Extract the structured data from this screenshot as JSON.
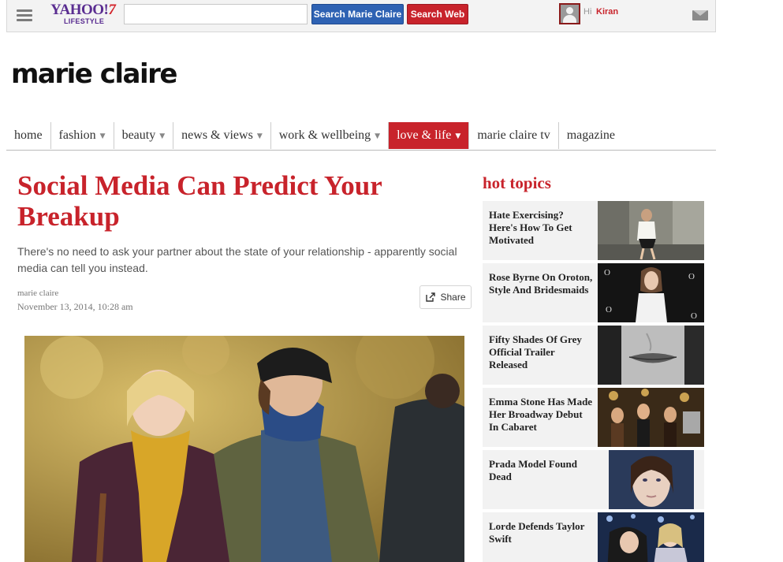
{
  "topbar": {
    "logo_text": "YAHOO!",
    "logo_seven": "7",
    "logo_sub": "LIFESTYLE",
    "search_value": "",
    "search_mc_label": "Search Marie Claire",
    "search_web_label": "Search Web",
    "greeting": "Hi",
    "username": "Kiran"
  },
  "brand": {
    "name": "marie claire"
  },
  "nav": [
    {
      "label": "home",
      "dropdown": false
    },
    {
      "label": "fashion",
      "dropdown": true
    },
    {
      "label": "beauty",
      "dropdown": true
    },
    {
      "label": "news & views",
      "dropdown": true
    },
    {
      "label": "work & wellbeing",
      "dropdown": true
    },
    {
      "label": "love & life",
      "dropdown": true,
      "active": true
    },
    {
      "label": "marie claire tv",
      "dropdown": false
    },
    {
      "label": "magazine",
      "dropdown": false
    }
  ],
  "article": {
    "title": "Social Media Can Predict Your Breakup",
    "lede": "There's no need to ask your partner about the state of your relationship - apparently social media can tell you instead.",
    "byline": "marie claire",
    "date": "November 13, 2014, 10:28 am",
    "share_label": "Share"
  },
  "sidebar": {
    "title": "hot topics",
    "items": [
      {
        "text": "Hate Exercising? Here's How To Get Motivated"
      },
      {
        "text": "Rose Byrne On Oroton, Style And Bridesmaids"
      },
      {
        "text": "Fifty Shades Of Grey Official Trailer Released"
      },
      {
        "text": "Emma Stone Has Made Her Broadway Debut In Cabaret"
      },
      {
        "text": "Prada Model Found Dead"
      },
      {
        "text": "Lorde Defends Taylor Swift"
      }
    ]
  },
  "colors": {
    "accent": "#c8232b",
    "yahoo_purple": "#5a2d91",
    "search_blue": "#2e62b3"
  },
  "icons": {
    "menu": "hamburger-icon",
    "mail": "mail-icon",
    "share": "share-icon",
    "avatar": "user-avatar-icon",
    "chevron": "chevron-down-icon"
  }
}
